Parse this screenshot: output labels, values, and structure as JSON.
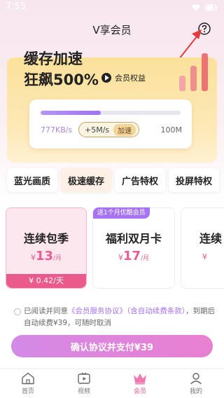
{
  "status_bar": {
    "time": "7:55"
  },
  "header": {
    "title": "V享会员",
    "help_icon": "question-circle-icon"
  },
  "hero": {
    "title_line1": "缓存加速",
    "title_line2": "狂飙500%",
    "rights_button": "会员权益",
    "speed_card": {
      "current_speed": "777KB/s",
      "boost_amount": "+5M/s",
      "boost_tag": "加速",
      "max_speed": "100M",
      "progress": 0.43
    }
  },
  "features": [
    "蓝光画质",
    "极速缓存",
    "广告特权",
    "投屏特权"
  ],
  "plans": [
    {
      "name": "连续包季",
      "currency": "¥",
      "price": "13",
      "unit": "/月",
      "footer": "¥ 0.42/天",
      "badge": ""
    },
    {
      "name": "福利双月卡",
      "currency": "¥",
      "price": "17",
      "unit": "/月",
      "footer": "",
      "badge": "送1个月优酷会员"
    },
    {
      "name": "连续",
      "currency": "¥",
      "price": "",
      "unit": "",
      "footer": "",
      "badge": ""
    }
  ],
  "agreement": {
    "prefix": "已阅读并同意",
    "service_link": "《会员服务协议》",
    "auto_link": "（含自动续费条款）",
    "suffix": "，到期后自动续费¥39，可随时取消"
  },
  "confirm_button": "确认协议并支付¥39",
  "tabbar": [
    {
      "label": "首页",
      "icon": "home-icon"
    },
    {
      "label": "视频",
      "icon": "video-icon"
    },
    {
      "label": "会员",
      "icon": "crown-icon"
    },
    {
      "label": "我的",
      "icon": "user-icon"
    }
  ],
  "colors": {
    "accent_pink": "#e85d92",
    "accent_purple": "#a673f2",
    "hero_yellow": "#fbe19a"
  }
}
